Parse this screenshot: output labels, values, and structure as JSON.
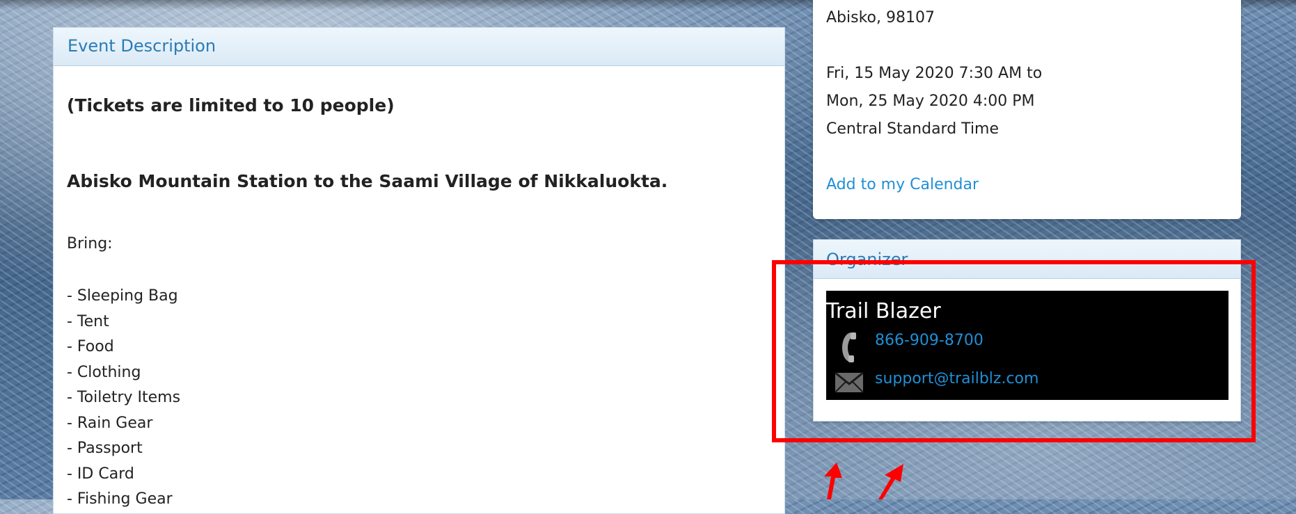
{
  "event_description": {
    "header": "Event Description",
    "ticket_limit": "(Tickets are limited to 10 people)",
    "route": "Abisko Mountain Station to the Saami Village of Nikkaluokta.",
    "bring_label": "Bring:",
    "bring_items": [
      "- Sleeping Bag",
      "- Tent",
      "- Food",
      "- Clothing",
      "- Toiletry Items",
      "- Rain Gear",
      "- Passport",
      "- ID Card",
      "- Fishing Gear"
    ]
  },
  "event_info": {
    "location": "Abisko, 98107",
    "date_start": "Fri, 15 May 2020 7:30 AM to",
    "date_end": "Mon, 25 May 2020 4:00 PM",
    "timezone": "Central Standard Time",
    "calendar_link": "Add to my Calendar"
  },
  "organizer": {
    "header": "Organizer",
    "name": "Trail Blazer",
    "phone": "866-909-8700",
    "email": "support@trailblz.com"
  },
  "icons": {
    "phone": "phone-icon",
    "email": "envelope-icon"
  },
  "colors": {
    "link": "#1f8fd6",
    "header_text": "#2b7bb5",
    "highlight": "#ff0000"
  }
}
